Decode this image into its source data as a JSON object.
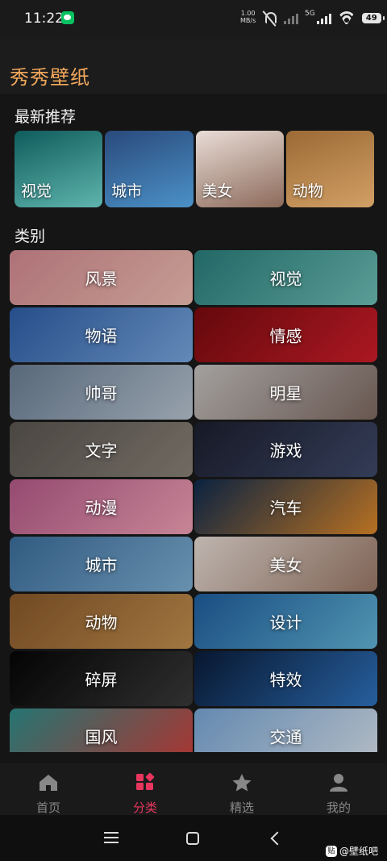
{
  "status": {
    "time": "11:22",
    "net_speed_value": "1.00",
    "net_speed_unit": "MB/s",
    "net_type": "5G",
    "battery": "49"
  },
  "app": {
    "title": "秀秀壁纸"
  },
  "recent": {
    "title": "最新推荐",
    "items": [
      {
        "label": "视觉",
        "colors": [
          "#0f5c5c",
          "#5fb5ae"
        ]
      },
      {
        "label": "城市",
        "colors": [
          "#2a4a7c",
          "#4b91c7"
        ]
      },
      {
        "label": "美女",
        "colors": [
          "#e9ddd7",
          "#8c6a5a"
        ]
      },
      {
        "label": "动物",
        "colors": [
          "#9b6a35",
          "#d2a066"
        ]
      }
    ]
  },
  "categories": {
    "title": "类别",
    "items": [
      {
        "label": "风景",
        "colors": [
          "#d48b92",
          "#f2c0b4"
        ]
      },
      {
        "label": "视觉",
        "colors": [
          "#2a7f7c",
          "#6fc0b8"
        ]
      },
      {
        "label": "物语",
        "colors": [
          "#2f5fa8",
          "#7aa8e0"
        ]
      },
      {
        "label": "情感",
        "colors": [
          "#7a0b10",
          "#d21e2a"
        ]
      },
      {
        "label": "帅哥",
        "colors": [
          "#6b7f95",
          "#b9c6d3"
        ]
      },
      {
        "label": "明星",
        "colors": [
          "#c7c4c2",
          "#7f6a62"
        ]
      },
      {
        "label": "文字",
        "colors": [
          "#5b5650",
          "#8a8378"
        ]
      },
      {
        "label": "游戏",
        "colors": [
          "#1c1f2e",
          "#3f4a6b"
        ]
      },
      {
        "label": "动漫",
        "colors": [
          "#b65b8a",
          "#f2a3b7"
        ]
      },
      {
        "label": "汽车",
        "colors": [
          "#0d2a4f",
          "#e08a2a"
        ]
      },
      {
        "label": "城市",
        "colors": [
          "#3d6f9e",
          "#7fb0d5"
        ]
      },
      {
        "label": "美女",
        "colors": [
          "#e8ddd6",
          "#9c7a68"
        ]
      },
      {
        "label": "动物",
        "colors": [
          "#8a5a2b",
          "#c4904f"
        ]
      },
      {
        "label": "设计",
        "colors": [
          "#1f5fa0",
          "#63b6d8"
        ]
      },
      {
        "label": "碎屏",
        "colors": [
          "#050505",
          "#3a3a3a"
        ]
      },
      {
        "label": "特效",
        "colors": [
          "#0a1c3a",
          "#2f74c0"
        ]
      },
      {
        "label": "国风",
        "colors": [
          "#2e8f8c",
          "#d0413d"
        ]
      },
      {
        "label": "交通",
        "colors": [
          "#7aa8d8",
          "#d9e4ef"
        ]
      }
    ]
  },
  "nav": {
    "items": [
      {
        "label": "首页",
        "icon": "home-icon"
      },
      {
        "label": "分类",
        "icon": "category-icon",
        "active": true
      },
      {
        "label": "精选",
        "icon": "star-icon"
      },
      {
        "label": "我的",
        "icon": "person-icon"
      }
    ],
    "active_color": "#e8355e",
    "inactive_color": "#888888"
  },
  "watermark": {
    "badge": "贴",
    "text": "@壁纸吧"
  }
}
